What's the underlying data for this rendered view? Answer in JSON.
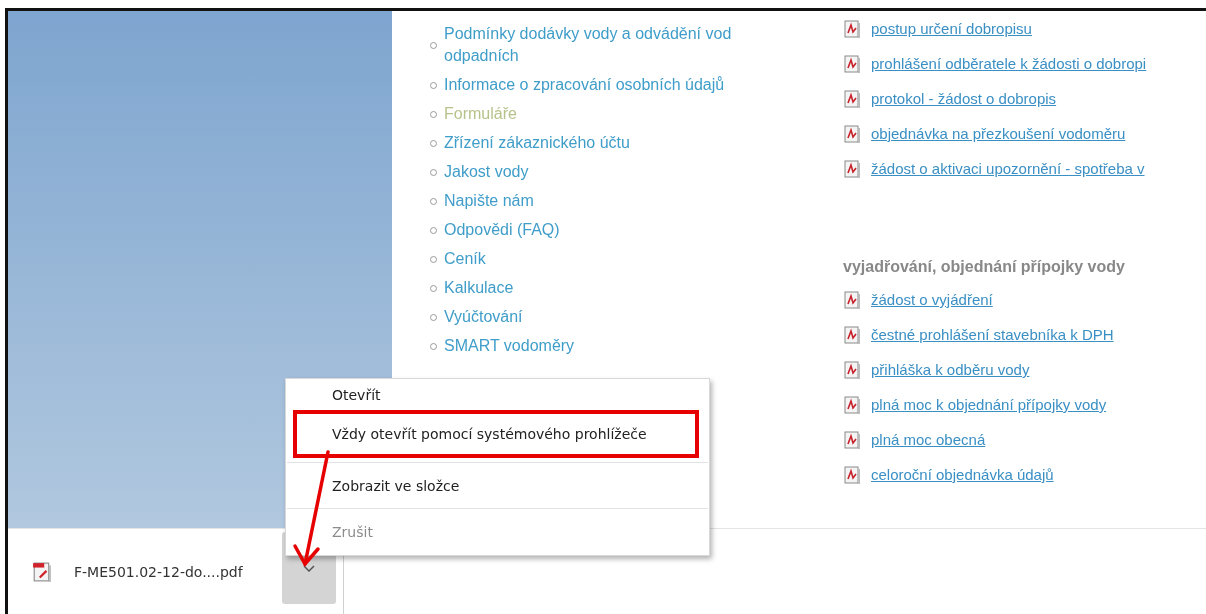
{
  "nav_items": [
    {
      "label": "Podmínky dodávky vody a odvádění vod odpadních",
      "selected": false
    },
    {
      "label": "Informace o zpracování osobních údajů",
      "selected": false
    },
    {
      "label": "Formuláře",
      "selected": true
    },
    {
      "label": "Zřízení zákaznického účtu",
      "selected": false
    },
    {
      "label": "Jakost vody",
      "selected": false
    },
    {
      "label": "Napište nám",
      "selected": false
    },
    {
      "label": "Odpovědi (FAQ)",
      "selected": false
    },
    {
      "label": "Ceník",
      "selected": false
    },
    {
      "label": "Kalkulace",
      "selected": false
    },
    {
      "label": "Vyúčtování",
      "selected": false
    },
    {
      "label": "SMART vodoměry",
      "selected": false
    }
  ],
  "credit_note_links": [
    "postup určení dobropisu",
    "prohlášení odběratele k žádosti o dobropi",
    "protokol - žádost o dobropis",
    "objednávka na přezkoušení vodoměru",
    "žádost o aktivaci upozornění - spotřeba v"
  ],
  "connection_section": {
    "heading": "vyjadřování, objednání přípojky vody",
    "links": [
      "žádost o vyjádření",
      "čestné prohlášení stavebníka k DPH",
      "přihláška k odběru vody",
      "plná moc k objednání přípojky vody",
      "plná moc obecná",
      "celoroční objednávka údajů"
    ]
  },
  "download_bar": {
    "filename": "F-ME501.02-12-do....pdf"
  },
  "context_menu": {
    "items": [
      {
        "label": "Otevřít",
        "disabled": false,
        "highlighted": false,
        "separator_after": false
      },
      {
        "label": "Vždy otevřít pomocí systémového prohlížeče",
        "disabled": false,
        "highlighted": true,
        "separator_after": true
      },
      {
        "label": "Zobrazit ve složce",
        "disabled": false,
        "highlighted": false,
        "separator_after": true
      },
      {
        "label": "Zrušit",
        "disabled": true,
        "highlighted": false,
        "separator_after": false
      }
    ]
  }
}
